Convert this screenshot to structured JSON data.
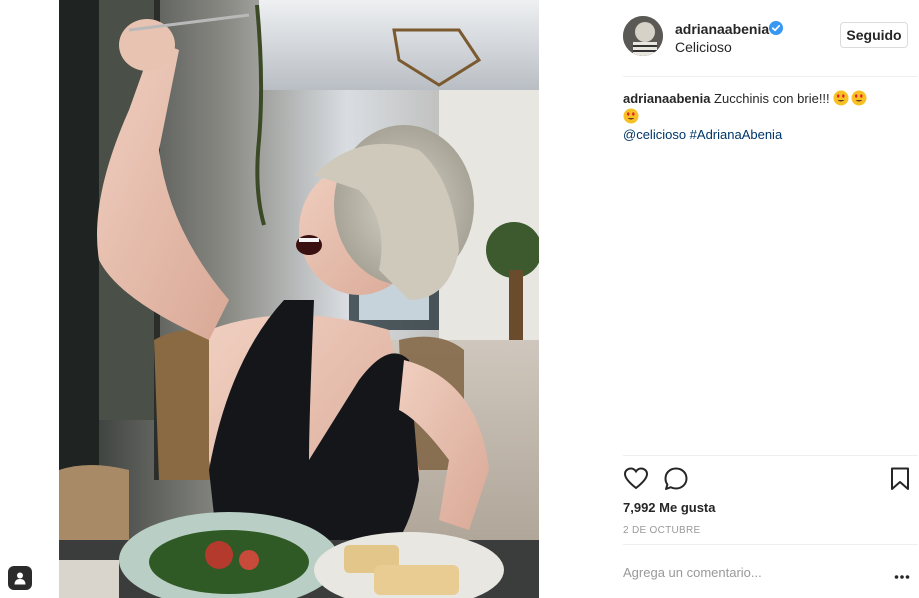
{
  "post": {
    "user": "adrianaabenia",
    "location": "Celicioso",
    "follow_label": "Seguido",
    "caption_text": " Zucchinis con brie!!!",
    "caption_mentions": "@celicioso #AdrianaAbenia",
    "likes": "7,992 Me gusta",
    "date": "2 DE OCTUBRE",
    "comment_placeholder": "Agrega un comentario..."
  },
  "icons": {
    "like": "heart-outline-icon",
    "comment": "speech-bubble-icon",
    "save": "bookmark-icon",
    "more": "ellipsis-icon",
    "verified": "verified-badge-icon",
    "emoji": "heart-eyes-emoji"
  },
  "colors": {
    "link": "#003569",
    "verified": "#3897f0",
    "muted": "#999999",
    "border": "#dbdbdb"
  }
}
